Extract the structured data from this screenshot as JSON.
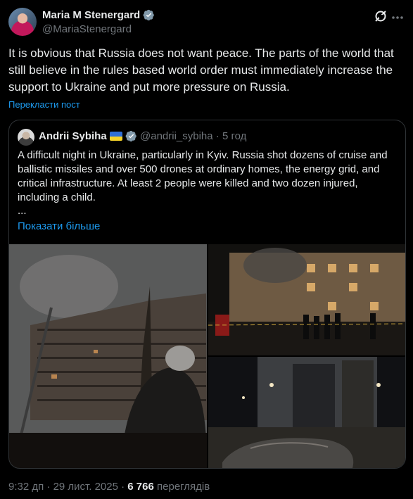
{
  "post": {
    "author_name": "Maria M Stenergard",
    "handle": "@MariaStenergard",
    "text": "It is obvious that Russia does not want peace. The parts of the world that still believe in the rules based world order must immediately increase the support to Ukraine and put more pressure on Russia.",
    "translate_label": "Перекласти пост"
  },
  "quote": {
    "author_name": "Andrii Sybiha",
    "handle_time": "@andrii_sybiha · 5 год",
    "text": "A difficult night in Ukraine, particularly in Kyiv. Russia shot dozens of cruise and ballistic missiles and over 500 drones at ordinary homes, the energy grid, and critical infrastructure. At least 2 people were killed and two dozen injured, including a child.",
    "ellipsis": "...",
    "show_more": "Показати більше"
  },
  "footer": {
    "time_date": "9:32 дп · 29 лист. 2025 ·",
    "views_count": "6 766",
    "views_label": "переглядів"
  },
  "colors": {
    "background": "#000000",
    "accent": "#1d9bf0",
    "muted": "#71767b"
  },
  "icons": [
    "verified-badge-icon",
    "grok-icon",
    "more-options-icon",
    "ukraine-flag-icon"
  ]
}
